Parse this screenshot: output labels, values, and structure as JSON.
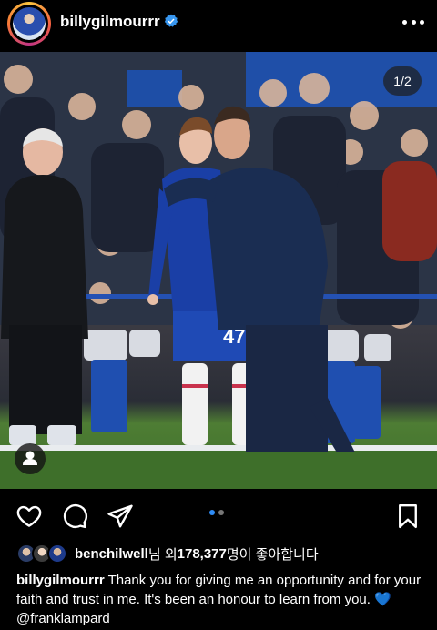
{
  "header": {
    "username": "billygilmourrr",
    "more_icon": "more-horizontal-icon",
    "verified_icon": "verified-badge-icon"
  },
  "photo": {
    "counter": "1/2",
    "player_number": "47",
    "user_tag_icon": "person-icon"
  },
  "actions": {
    "like_icon": "heart-outline-icon",
    "comment_icon": "comment-icon",
    "share_icon": "send-icon",
    "save_icon": "bookmark-icon",
    "carousel_index": 1,
    "carousel_total": 2
  },
  "likes": {
    "user": "benchilwell",
    "suffix": "님 외 ",
    "count": "178,377",
    "tail": "명이 좋아합니다"
  },
  "caption": {
    "author": "billygilmourrr",
    "text": " Thank you for giving me an opportunity and for your faith and trust in me. It's been an honour to learn from you. ",
    "emoji": "💙",
    "mention": "@franklampard"
  },
  "colors": {
    "accent_blue": "#2f8cf5",
    "background": "#000000",
    "verified_blue": "#3897f0"
  }
}
